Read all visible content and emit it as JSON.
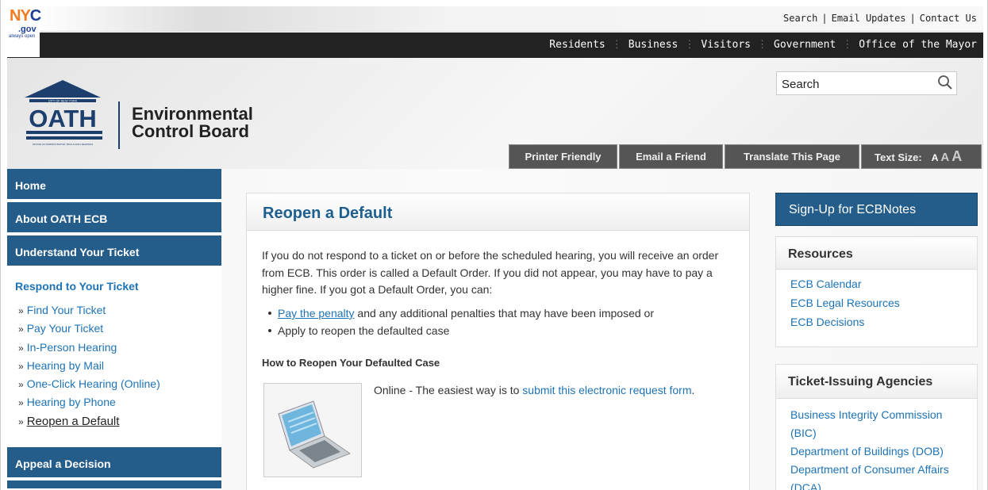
{
  "nyc_logo": {
    "nyc": "NYC",
    "gov": ".gov",
    "tagline": "always open"
  },
  "utility_links": [
    "Search",
    "Email Updates",
    "Contact Us"
  ],
  "utility_separator": "|",
  "main_nav": [
    "Residents",
    "Business",
    "Visitors",
    "Government",
    "Office of the Mayor"
  ],
  "main_nav_separator": "⋮",
  "header": {
    "logo": {
      "top_text": "CITY OF NEW YORK",
      "name": "OATH",
      "bottom_text": "OFFICE OF ADMINISTRATIVE TRIALS AND HEARINGS"
    },
    "agency_line1": "Environmental",
    "agency_line2": "Control Board",
    "search_placeholder": "Search",
    "tools": {
      "printer": "Printer Friendly",
      "email": "Email a Friend",
      "translate": "Translate This Page",
      "text_size_label": "Text Size:",
      "text_size_options": [
        "A",
        "A",
        "A"
      ]
    }
  },
  "sidebar": {
    "tabs": {
      "home": "Home",
      "about": "About OATH ECB",
      "understand": "Understand Your Ticket",
      "appeal": "Appeal a Decision"
    },
    "section_title": "Respond to Your Ticket",
    "bullet": "»",
    "links": [
      "Find Your Ticket",
      "Pay Your Ticket",
      "In-Person Hearing",
      "Hearing by Mail",
      "One-Click Hearing (Online)",
      "Hearing by Phone",
      "Reopen a Default"
    ]
  },
  "main": {
    "title": "Reopen a Default",
    "intro": "If you do not respond to a ticket on or before the scheduled hearing, you will receive an order from ECB. This order is called a Default Order. If you did not appear, you may have to pay a higher fine. If you got a Default Order, you can:",
    "bullet1_link": "Pay the penalty",
    "bullet1_rest": " and any additional penalties that may have been imposed or",
    "bullet2": "Apply to reopen the defaulted case",
    "how_heading": "How to Reopen Your Defaulted Case",
    "online_label": "Online",
    "online_dash": " - ",
    "online_text": "The easiest way is to ",
    "online_link": "submit this electronic request form",
    "online_end": "."
  },
  "right": {
    "signup": "Sign-Up for ECBNotes",
    "resources_title": "Resources",
    "resources": [
      "ECB Calendar",
      "ECB Legal Resources",
      "ECB Decisions"
    ],
    "agencies_title": "Ticket-Issuing Agencies",
    "agencies": [
      "Business Integrity Commission (BIC)",
      "Department of Buildings (DOB)",
      "Department of Consumer Affairs (DCA)"
    ]
  },
  "colors": {
    "nav_blue": "#245c8a",
    "link_blue": "#1d73b6",
    "title_blue": "#1d5f8f",
    "nyc_orange": "#f47b20",
    "nyc_blue": "#1c3f94"
  }
}
